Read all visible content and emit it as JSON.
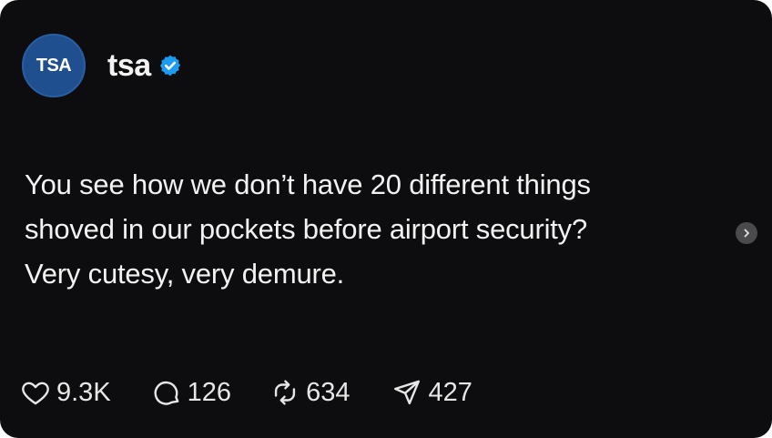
{
  "post": {
    "avatar_text": "TSA",
    "username": "tsa",
    "verified": true,
    "text_lines": [
      "You see how we don’t have 20 different things",
      "shoved in our pockets before airport security?",
      "Very cutesy, very demure."
    ],
    "actions": {
      "likes": "9.3K",
      "replies": "126",
      "reposts": "634",
      "shares": "427"
    }
  },
  "colors": {
    "background": "#0d0d0f",
    "text": "#f2f2f2",
    "avatar": "#1f4f8f",
    "verified_badge": "#1d9bf0"
  },
  "icons": [
    "heart-icon",
    "comment-icon",
    "repost-icon",
    "share-icon",
    "verified-badge-icon",
    "chevron-right-icon"
  ]
}
